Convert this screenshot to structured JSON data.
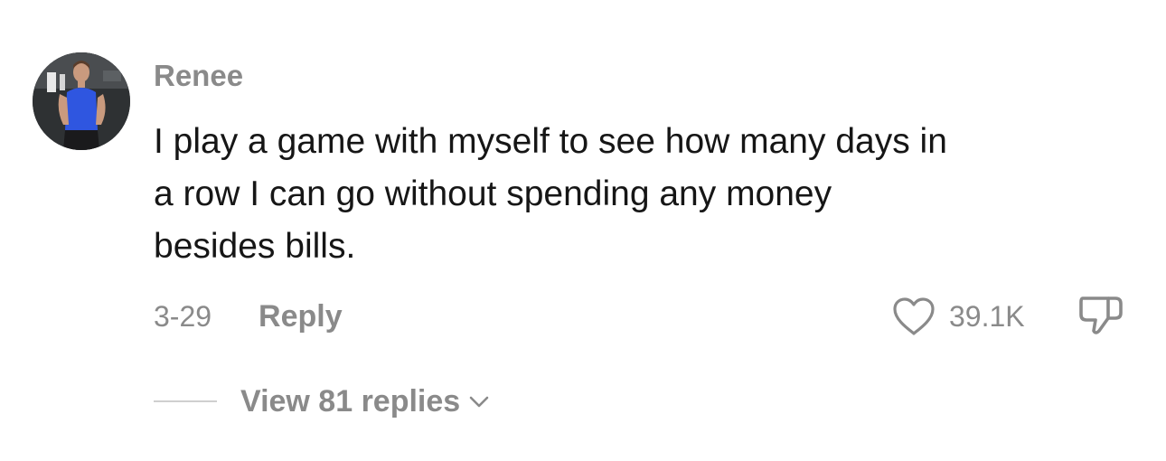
{
  "comment": {
    "username": "Renee",
    "text_lines": [
      "I play a game with myself to see how many days in",
      "a row I can go without spending any money",
      "besides bills."
    ],
    "date": "3-29",
    "reply_label": "Reply",
    "like_count": "39.1K",
    "view_replies_label": "View 81 replies"
  },
  "icons": {
    "like": "heart-icon",
    "dislike": "thumbs-down-icon",
    "expand": "chevron-down-icon"
  },
  "colors": {
    "username": "#8a8a8a",
    "text": "#161616",
    "secondary": "#8a8a8a",
    "divider": "#cfcfcf"
  }
}
